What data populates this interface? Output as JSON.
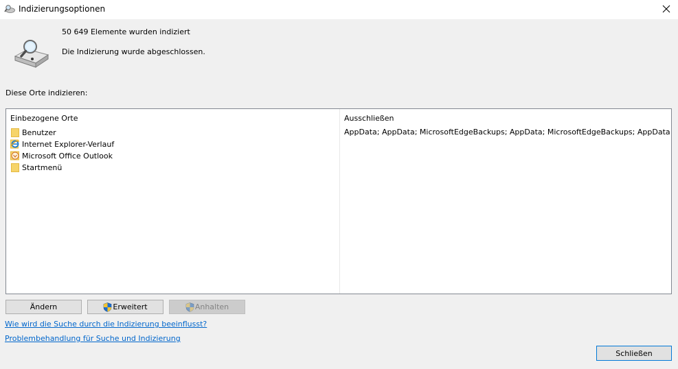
{
  "window": {
    "title": "Indizierungsoptionen",
    "title_icon": "indexing-options-icon",
    "close_icon": "close-icon"
  },
  "status": {
    "icon": "drive-magnifier-icon",
    "item_count": "50 649 Elemente wurden indiziert",
    "state": "Die Indizierung wurde abgeschlossen."
  },
  "locations": {
    "label": "Diese Orte indizieren:",
    "included_header": "Einbezogene Orte",
    "excluded_header": "Ausschließen",
    "items": [
      {
        "label": "Benutzer",
        "icon": "folder-icon"
      },
      {
        "label": "Internet Explorer-Verlauf",
        "icon": "internet-explorer-icon"
      },
      {
        "label": "Microsoft Office Outlook",
        "icon": "outlook-icon"
      },
      {
        "label": "Startmenü",
        "icon": "folder-icon"
      }
    ],
    "excluded_text": "AppData; AppData; MicrosoftEdgeBackups; AppData; MicrosoftEdgeBackups; AppData"
  },
  "buttons": {
    "change": "Ändern",
    "advanced": "Erweitert",
    "pause": "Anhalten",
    "close": "Schließen"
  },
  "links": {
    "search_influence": "Wie wird die Suche durch die Indizierung beeinflusst?",
    "troubleshoot": "Problembehandlung für Suche und Indizierung"
  },
  "colors": {
    "link": "#0066cc",
    "default_button_border": "#0078d7",
    "folder": "#f6d46a"
  }
}
